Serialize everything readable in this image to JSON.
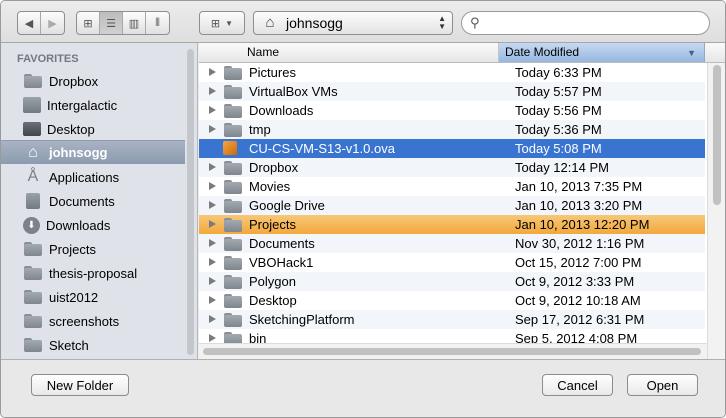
{
  "toolbar": {
    "location": "johnsogg",
    "search_placeholder": "",
    "back_icon": "chevron-left-icon",
    "forward_icon": "chevron-right-icon"
  },
  "sidebar": {
    "heading": "FAVORITES",
    "items": [
      {
        "label": "Dropbox",
        "icon": "folder-icon"
      },
      {
        "label": "Intergalactic",
        "icon": "disk-icon"
      },
      {
        "label": "Desktop",
        "icon": "desktop-icon"
      },
      {
        "label": "johnsogg",
        "icon": "home-icon",
        "selected": true
      },
      {
        "label": "Applications",
        "icon": "applications-icon"
      },
      {
        "label": "Documents",
        "icon": "documents-icon"
      },
      {
        "label": "Downloads",
        "icon": "downloads-icon"
      },
      {
        "label": "Projects",
        "icon": "folder-icon"
      },
      {
        "label": "thesis-proposal",
        "icon": "folder-icon"
      },
      {
        "label": "uist2012",
        "icon": "folder-icon"
      },
      {
        "label": "screenshots",
        "icon": "folder-icon"
      },
      {
        "label": "Sketch",
        "icon": "folder-icon"
      }
    ]
  },
  "list": {
    "col_name": "Name",
    "col_date": "Date Modified",
    "rows": [
      {
        "name": "Pictures",
        "date": "Today 6:33 PM"
      },
      {
        "name": "VirtualBox VMs",
        "date": "Today 5:57 PM"
      },
      {
        "name": "Downloads",
        "date": "Today 5:56 PM"
      },
      {
        "name": "tmp",
        "date": "Today 5:36 PM"
      },
      {
        "name": "CU-CS-VM-S13-v1.0.ova",
        "date": "Today 5:08 PM"
      },
      {
        "name": "Dropbox",
        "date": "Today 12:14 PM"
      },
      {
        "name": "Movies",
        "date": "Jan 10, 2013 7:35 PM"
      },
      {
        "name": "Google Drive",
        "date": "Jan 10, 2013 3:20 PM"
      },
      {
        "name": "Projects",
        "date": "Jan 10, 2013 12:20 PM"
      },
      {
        "name": "Documents",
        "date": "Nov 30, 2012 1:16 PM"
      },
      {
        "name": "VBOHack1",
        "date": "Oct 15, 2012 7:00 PM"
      },
      {
        "name": "Polygon",
        "date": "Oct 9, 2012 3:33 PM"
      },
      {
        "name": "Desktop",
        "date": "Oct 9, 2012 10:18 AM"
      },
      {
        "name": "SketchingPlatform",
        "date": "Sep 17, 2012 6:31 PM"
      },
      {
        "name": "bin",
        "date": "Sep 5, 2012 4:08 PM"
      }
    ]
  },
  "buttons": {
    "new_folder": "New Folder",
    "cancel": "Cancel",
    "open": "Open"
  },
  "colors": {
    "selection": "#3a74d1",
    "highlight": "#f2a83c",
    "sidebar_bg": "#dfe3e9"
  }
}
